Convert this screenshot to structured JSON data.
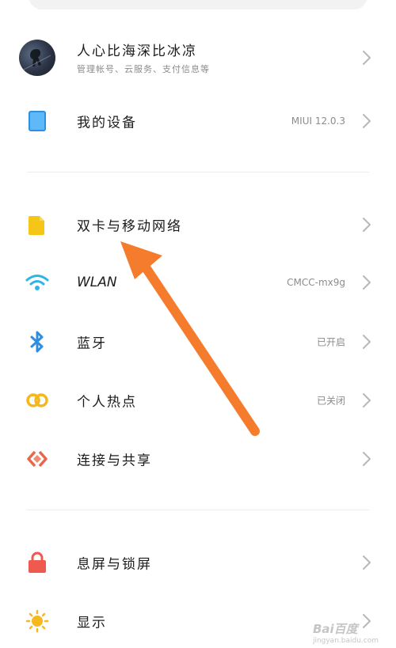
{
  "account": {
    "name": "人心比海深比冰凉",
    "subtitle": "管理帐号、云服务、支付信息等",
    "avatar_icon": "avatar"
  },
  "device": {
    "label": "我的设备",
    "value": "MIUI 12.0.3",
    "icon": "phone-device-icon",
    "color": "#3aa0f0"
  },
  "network_items": [
    {
      "label": "双卡与移动网络",
      "value": "",
      "icon": "sim-card-icon",
      "color": "#f5c518"
    },
    {
      "label": "WLAN",
      "value": "CMCC-mx9g",
      "icon": "wifi-icon",
      "color": "#2fb4e6"
    },
    {
      "label": "蓝牙",
      "value": "已开启",
      "icon": "bluetooth-icon",
      "color": "#2f8de0"
    },
    {
      "label": "个人热点",
      "value": "已关闭",
      "icon": "hotspot-icon",
      "color": "#f3b81c"
    },
    {
      "label": "连接与共享",
      "value": "",
      "icon": "share-icon",
      "color": "#e8664a"
    }
  ],
  "display_items": [
    {
      "label": "息屏与锁屏",
      "value": "",
      "icon": "lock-icon",
      "color": "#ef5a4e"
    },
    {
      "label": "显示",
      "value": "",
      "icon": "sun-icon",
      "color": "#f7b81f"
    }
  ],
  "annotation": {
    "arrow_color": "#f47c2c"
  },
  "watermark": {
    "main": "Bai百度",
    "sub": "jingyan.baidu.com"
  }
}
